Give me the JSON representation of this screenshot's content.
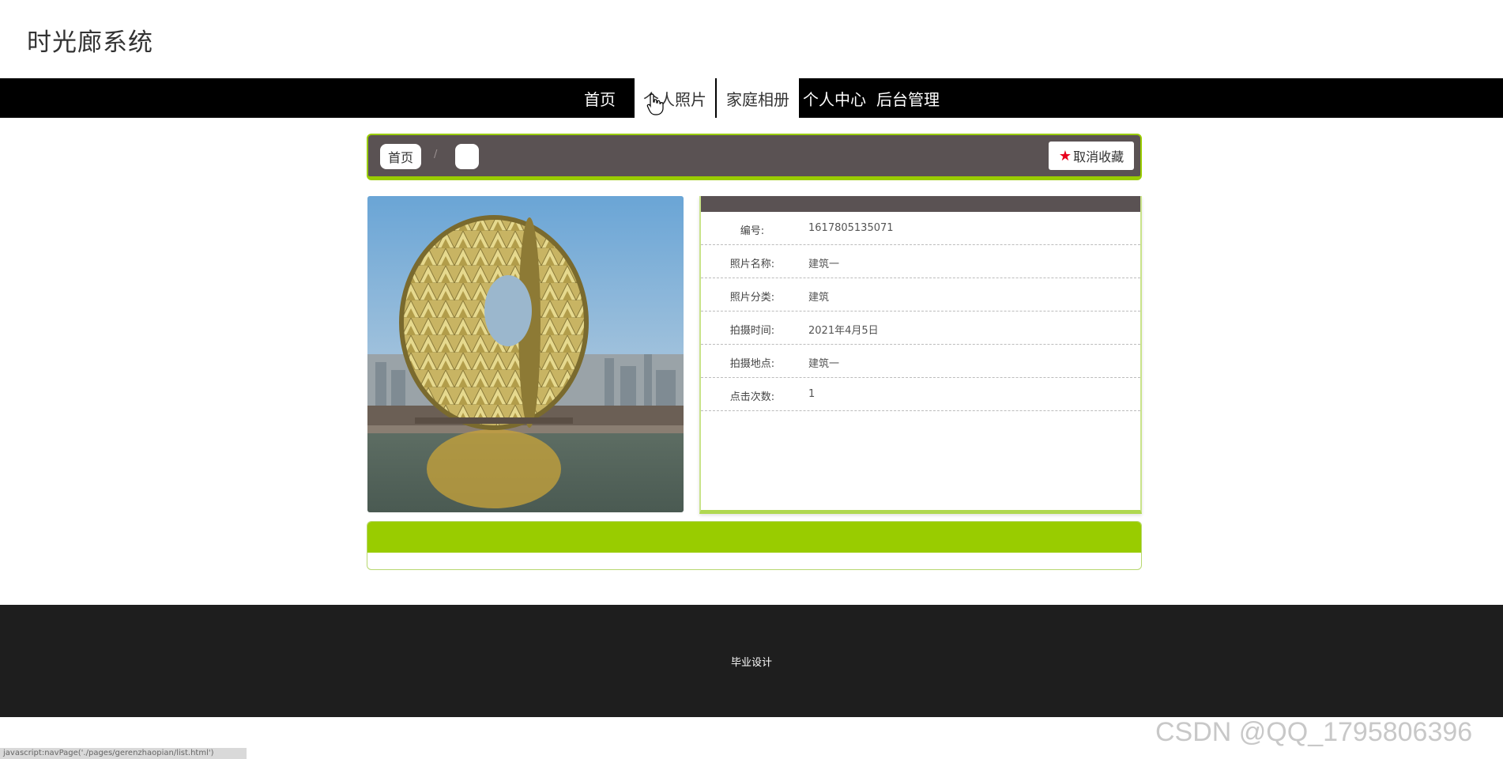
{
  "site": {
    "title": "时光廊系统"
  },
  "nav": {
    "items": [
      {
        "label": "首页"
      },
      {
        "label": "个人照片"
      },
      {
        "label": "家庭相册"
      },
      {
        "label": "个人中心"
      },
      {
        "label": "后台管理"
      }
    ]
  },
  "breadcrumb": {
    "home": "首页",
    "separator": "/",
    "current": ""
  },
  "favorite_button": {
    "label": "取消收藏",
    "icon": "star-icon",
    "icon_color": "#e8001c"
  },
  "photo": {
    "subject": "round-building-photo"
  },
  "details": {
    "rows": [
      {
        "label": "编号:",
        "value": "1617805135071"
      },
      {
        "label": "照片名称:",
        "value": "建筑一"
      },
      {
        "label": "照片分类:",
        "value": "建筑"
      },
      {
        "label": "拍摄时间:",
        "value": "2021年4月5日"
      },
      {
        "label": "拍摄地点:",
        "value": "建筑一"
      },
      {
        "label": "点击次数:",
        "value": "1"
      }
    ]
  },
  "footer": {
    "text": "毕业设计"
  },
  "status_bar": {
    "url": "javascript:navPage('./pages/gerenzhaopian/list.html')"
  },
  "watermark": "CSDN @QQ_1795806396",
  "colors": {
    "accent": "#99cc00",
    "header_dark": "#5a5253",
    "nav": "#000000",
    "footer": "#1e1e1e"
  }
}
